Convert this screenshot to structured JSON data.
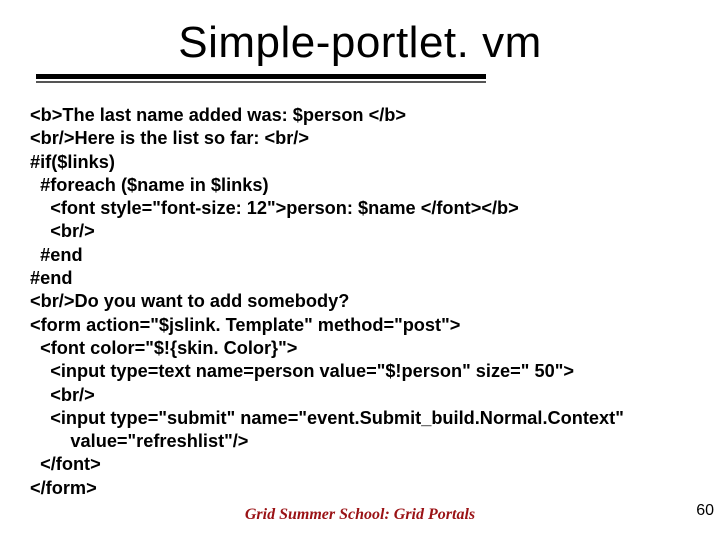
{
  "title": "Simple-portlet. vm",
  "code": "<b>The last name added was: $person </b>\n<br/>Here is the list so far: <br/>\n#if($links)\n  #foreach ($name in $links)\n    <font style=\"font-size: 12\">person: $name </font></b>\n    <br/>\n  #end\n#end\n<br/>Do you want to add somebody?\n<form action=\"$jslink. Template\" method=\"post\">\n  <font color=\"$!{skin. Color}\">\n    <input type=text name=person value=\"$!person\" size=\" 50\">\n    <br/>\n    <input type=\"submit\" name=\"event.Submit_build.Normal.Context\"\n        value=\"refreshlist\"/>\n  </font>\n</form>",
  "footer": "Grid Summer School: Grid Portals",
  "page_number": "60"
}
